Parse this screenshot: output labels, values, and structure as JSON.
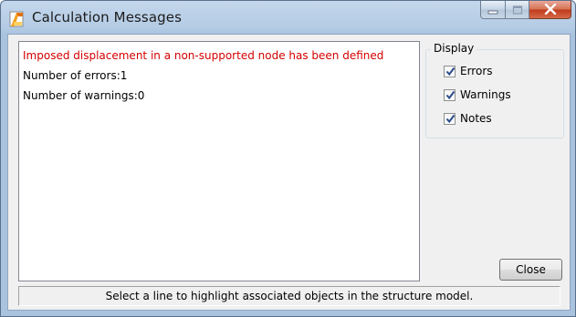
{
  "window": {
    "title": "Calculation Messages",
    "app_icon": "robot-structural-app-icon",
    "controls": [
      "minimize-icon",
      "maximize-icon",
      "close-icon"
    ]
  },
  "messages": [
    {
      "text": "Imposed displacement in a non-supported node has been defined",
      "type": "error"
    },
    {
      "text": "Number of errors:1",
      "type": "info"
    },
    {
      "text": "Number of warnings:0",
      "type": "info"
    }
  ],
  "display": {
    "label": "Display",
    "options": [
      {
        "label": "Errors",
        "checked": true
      },
      {
        "label": "Warnings",
        "checked": true
      },
      {
        "label": "Notes",
        "checked": true
      }
    ]
  },
  "close_button": "Close",
  "status_text": "Select a line to highlight associated objects in the structure model.",
  "colors": {
    "error_text": "#d40000",
    "title_bar": "#b3cbe4",
    "close_button_red": "#c0391b"
  }
}
